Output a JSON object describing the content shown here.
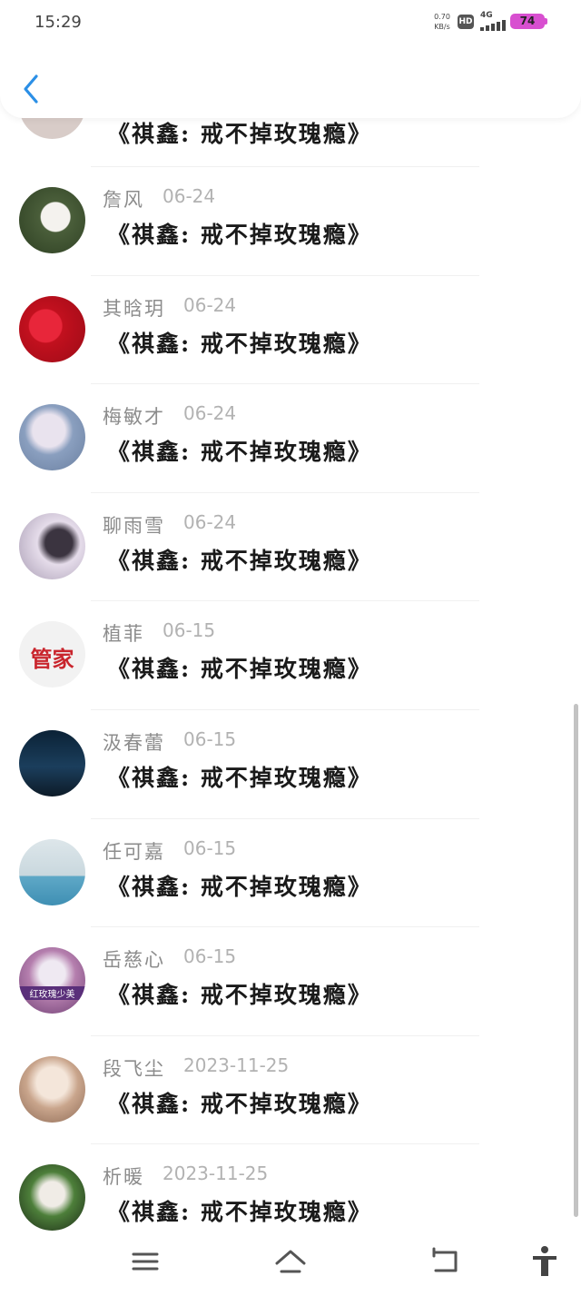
{
  "status_bar": {
    "time": "15:29",
    "net_speed": "0.70",
    "net_unit": "KB/s",
    "hd": "HD",
    "signal": "4G",
    "battery": "74"
  },
  "header": {
    "back_icon": "chevron-left-icon",
    "accent": "#2b8fe6"
  },
  "comments": [
    {
      "name": "",
      "date": "",
      "message": "《祺鑫: 戒不掉玫瑰瘾》"
    },
    {
      "name": "詹风",
      "date": "06-24",
      "message": "《祺鑫: 戒不掉玫瑰瘾》"
    },
    {
      "name": "其晗玥",
      "date": "06-24",
      "message": "《祺鑫: 戒不掉玫瑰瘾》"
    },
    {
      "name": "梅敏才",
      "date": "06-24",
      "message": "《祺鑫: 戒不掉玫瑰瘾》"
    },
    {
      "name": "聊雨雪",
      "date": "06-24",
      "message": "《祺鑫: 戒不掉玫瑰瘾》"
    },
    {
      "name": "植菲",
      "date": "06-15",
      "message": "《祺鑫: 戒不掉玫瑰瘾》",
      "avatar_text": "管家"
    },
    {
      "name": "汲春蕾",
      "date": "06-15",
      "message": "《祺鑫: 戒不掉玫瑰瘾》"
    },
    {
      "name": "任可嘉",
      "date": "06-15",
      "message": "《祺鑫: 戒不掉玫瑰瘾》"
    },
    {
      "name": "岳慈心",
      "date": "06-15",
      "message": "《祺鑫: 戒不掉玫瑰瘾》",
      "avatar_text": "红玫瑰少美"
    },
    {
      "name": "段飞尘",
      "date": "2023-11-25",
      "message": "《祺鑫: 戒不掉玫瑰瘾》"
    },
    {
      "name": "析暖",
      "date": "2023-11-25",
      "message": "《祺鑫: 戒不掉玫瑰瘾》"
    }
  ],
  "nav_bar": {
    "icons": [
      "menu-icon",
      "home-icon",
      "back-icon",
      "accessibility-icon"
    ]
  }
}
